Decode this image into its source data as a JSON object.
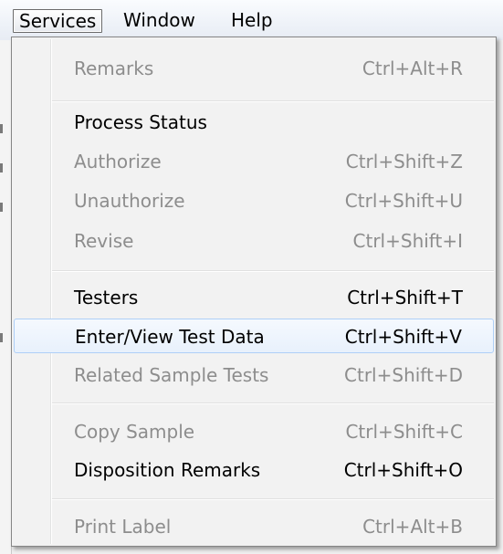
{
  "menubar": {
    "items": [
      {
        "label": "Services"
      },
      {
        "label": "Window"
      },
      {
        "label": "Help"
      }
    ]
  },
  "menu": {
    "items": [
      {
        "label": "Remarks",
        "shortcut": "Ctrl+Alt+R",
        "enabled": false
      },
      {
        "label": "Process Status",
        "shortcut": "",
        "enabled": true
      },
      {
        "label": "Authorize",
        "shortcut": "Ctrl+Shift+Z",
        "enabled": false
      },
      {
        "label": "Unauthorize",
        "shortcut": "Ctrl+Shift+U",
        "enabled": false
      },
      {
        "label": "Revise",
        "shortcut": "Ctrl+Shift+I",
        "enabled": false
      },
      {
        "label": "Testers",
        "shortcut": "Ctrl+Shift+T",
        "enabled": true
      },
      {
        "label": "Enter/View Test Data",
        "shortcut": "Ctrl+Shift+V",
        "enabled": true,
        "highlighted": true
      },
      {
        "label": "Related Sample Tests",
        "shortcut": "Ctrl+Shift+D",
        "enabled": false
      },
      {
        "label": "Copy Sample",
        "shortcut": "Ctrl+Shift+C",
        "enabled": false
      },
      {
        "label": "Disposition Remarks",
        "shortcut": "Ctrl+Shift+O",
        "enabled": true
      },
      {
        "label": "Print Label",
        "shortcut": "Ctrl+Alt+B",
        "enabled": false
      }
    ]
  },
  "colors": {
    "disabled_text": "#8d8d8d",
    "enabled_text": "#000000",
    "highlight_border": "#aecff7",
    "menu_background": "#f2f2f2"
  }
}
